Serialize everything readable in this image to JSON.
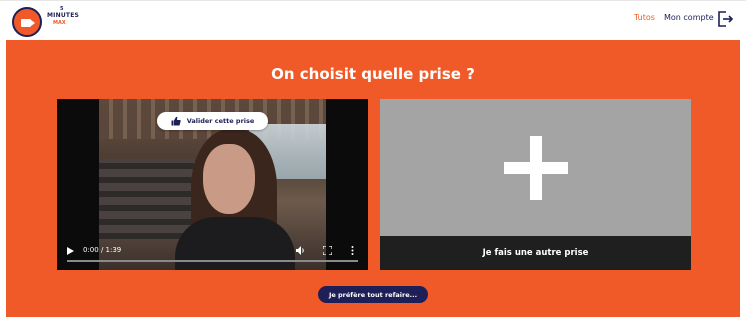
{
  "header": {
    "brand_number": "5",
    "brand_minutes": "MINUTES",
    "brand_max": "MAX",
    "nav_tutos": "Tutos",
    "nav_account": "Mon compte",
    "logout_icon": "logout-icon"
  },
  "main": {
    "title": "On choisit quelle prise ?",
    "video_card": {
      "validate_label": "Valider cette prise",
      "validate_icon": "thumbs-up-icon",
      "time": "0:00 / 1:39",
      "progress": 0
    },
    "add_card": {
      "label": "Je fais une autre prise",
      "icon": "plus-icon"
    },
    "redo_label": "Je préfère tout refaire..."
  },
  "colors": {
    "brand_orange": "#f05a28",
    "brand_navy": "#1d1f56",
    "card_gray": "#a4a4a4",
    "label_bar": "#1f1f1f"
  }
}
